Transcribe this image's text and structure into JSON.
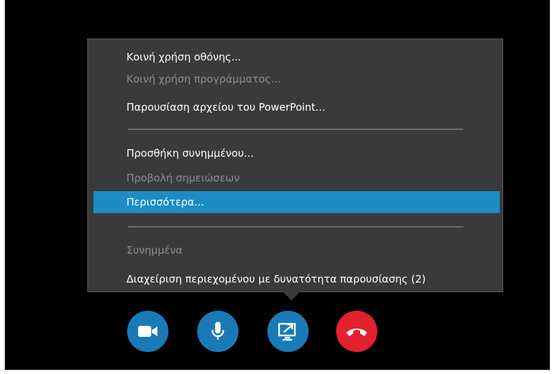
{
  "menu": {
    "items": [
      {
        "label": "Κοινή χρήση οθόνης...",
        "state": "enabled"
      },
      {
        "label": "Κοινή χρήση προγράμματος...",
        "state": "disabled"
      },
      {
        "label": "Παρουσίαση αρχείου του PowerPoint...",
        "state": "enabled"
      },
      {
        "label": "Προσθήκη συνημμένου...",
        "state": "enabled"
      },
      {
        "label": "Προβολή σημειώσεων",
        "state": "disabled"
      },
      {
        "label": "Περισσότερα...",
        "state": "highlighted"
      },
      {
        "label": "Συνημμένα",
        "state": "disabled"
      },
      {
        "label": "Διαχείριση περιεχομένου με δυνατότητα παρουσίασης (2)",
        "state": "enabled"
      }
    ]
  },
  "call_controls": {
    "buttons": [
      {
        "icon": "video-camera-icon",
        "color": "#1a7ab8"
      },
      {
        "icon": "microphone-icon",
        "color": "#1a7ab8"
      },
      {
        "icon": "share-screen-icon",
        "color": "#1a7ab8"
      },
      {
        "icon": "hang-up-icon",
        "color": "#e5202e"
      }
    ]
  },
  "colors": {
    "background": "#000000",
    "menu_background": "#3a3a3c",
    "highlight": "#1b8cc4",
    "disabled_text": "#8d8d8f"
  }
}
